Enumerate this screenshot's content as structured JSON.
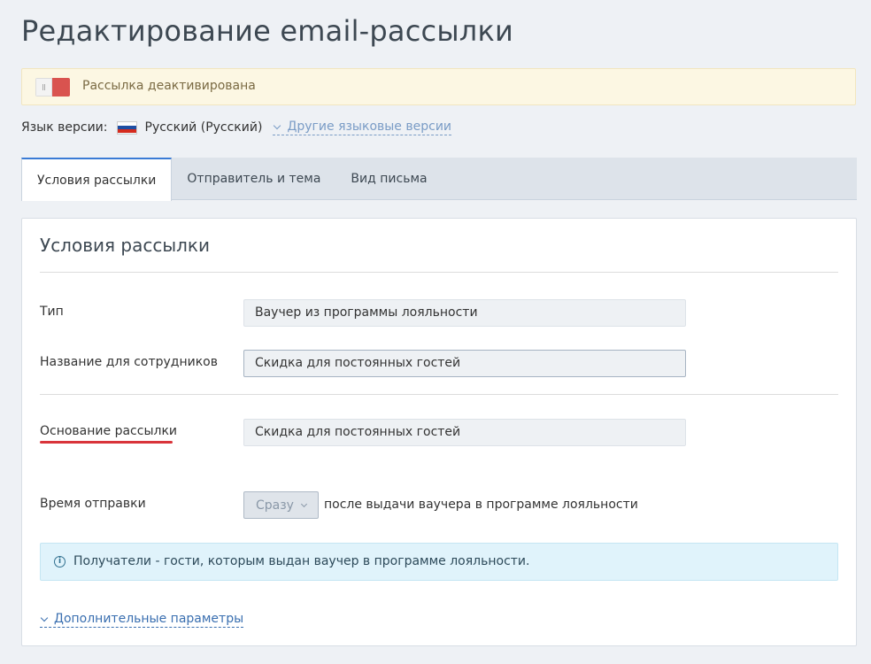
{
  "page_title": "Редактирование email-рассылки",
  "status": {
    "text": "Рассылка деактивирована",
    "toggle_state": "off",
    "toggle_color": "#d9534f"
  },
  "language": {
    "label": "Язык версии:",
    "flag_icon": "russia-flag-icon",
    "current": "Русский (Русский)",
    "other_versions": "Другие языковые версии"
  },
  "tabs": [
    {
      "label": "Условия рассылки",
      "active": true
    },
    {
      "label": "Отправитель и тема",
      "active": false
    },
    {
      "label": "Вид письма",
      "active": false
    }
  ],
  "panel": {
    "title": "Условия рассылки",
    "fields": {
      "type": {
        "label": "Тип",
        "value": "Ваучер из программы лояльности"
      },
      "staff_name": {
        "label": "Название для сотрудников",
        "value": "Скидка для постоянных гостей"
      },
      "basis": {
        "label": "Основание рассылки",
        "value": "Скидка для постоянных гостей"
      },
      "send_time": {
        "label": "Время отправки",
        "selected": "Сразу",
        "suffix": "после выдачи ваучера в программе лояльности"
      }
    },
    "info": {
      "icon": "info-icon",
      "text": "Получатели - гости, которым выдан ваучер в программе лояльности."
    },
    "extra_params": "Дополнительные параметры"
  },
  "colors": {
    "accent": "#3a7bd5",
    "highlight_underline": "#d9343a",
    "info_bg": "#e0f3fb",
    "alert_bg": "#fcf7e3"
  }
}
